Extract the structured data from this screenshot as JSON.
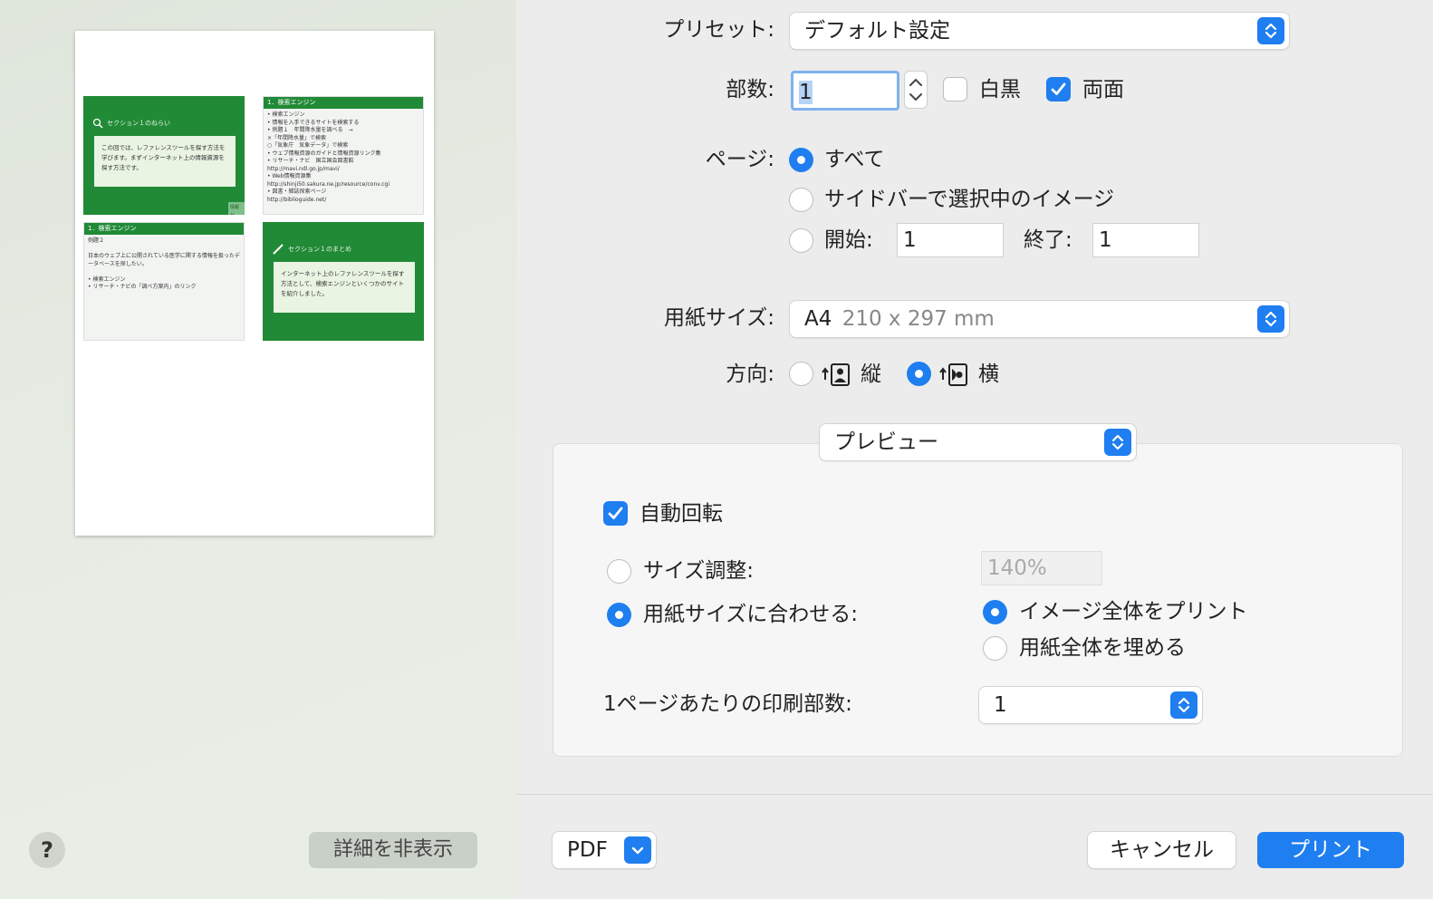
{
  "sidebar": {
    "slides": [
      {
        "heading": "セクション１のねらい",
        "box_text": "この回では、レファレンスツールを探す方法を学びます。まずインターネット上の情報資源を探す方法です。",
        "tag": "情報サ"
      },
      {
        "bar": "1．検索エンジン",
        "body": "• 検索エンジン\n  • 情報を入手できるサイトを検索する\n  • 例題１　年間降水量を調べる　→\n      ×「年間降水量」で検索\n      ○「気象庁　気象データ」で検索\n• ウェブ情報資源のガイドと情報資源リンク集\n  • リサーチ・ナビ　国立国会図書館\n    http://mavi.ndl.go.jp/mavi/\n  • Web情報資源集\n    http://shinji50.sakura.ne.jp/resource/conv.cgi\n  • 図書・雑誌探索ページ\n    http://biblioguide.net/"
      },
      {
        "bar": "1．検索エンジン",
        "body": "例題２\n\n  日本のウェブ上に公開されている医学に関する情報を扱ったデータベースを探したい。\n\n• 検索エンジン\n• リサーチ・ナビの「調べ方案内」のリンク"
      },
      {
        "heading": "セクション１のまとめ",
        "box_text": "インターネット上のレファレンスツールを探す方法として、検索エンジンといくつかのサイトを紹介しました。"
      }
    ],
    "help_label": "?",
    "hide_details_label": "詳細を非表示"
  },
  "print": {
    "preset_label": "プリセット:",
    "preset_value": "デフォルト設定",
    "copies_label": "部数:",
    "copies_value": "1",
    "bw_label": "白黒",
    "duplex_label": "両面",
    "pages_label": "ページ:",
    "pages_all": "すべて",
    "pages_sidebar": "サイドバーで選択中のイメージ",
    "pages_from_label": "開始:",
    "pages_from_value": "1",
    "pages_to_label": "終了:",
    "pages_to_value": "1",
    "paper_size_label": "用紙サイズ:",
    "paper_size_name": "A4",
    "paper_size_dims": "210 x 297 mm",
    "orientation_label": "方向:",
    "orientation_portrait": "縦",
    "orientation_landscape": "横",
    "section_value": "プレビュー",
    "auto_rotate_label": "自動回転",
    "scale_label": "サイズ調整:",
    "scale_value": "140%",
    "fit_label": "用紙サイズに合わせる:",
    "fit_entire_image": "イメージ全体をプリント",
    "fit_fill_paper": "用紙全体を埋める",
    "copies_per_page_label": "1ページあたりの印刷部数:",
    "copies_per_page_value": "1",
    "pdf_label": "PDF",
    "cancel_label": "キャンセル",
    "print_label": "プリント"
  },
  "colors": {
    "accent": "#1f7ef0",
    "slide_green": "#218a36"
  }
}
